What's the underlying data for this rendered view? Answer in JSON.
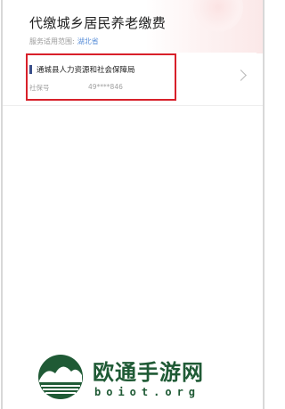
{
  "page": {
    "title": "代缴城乡居民养老缴费",
    "scope_label": "服务适用范围:",
    "scope_value": "湖北省"
  },
  "bureau_card": {
    "name": "通城县人力资源和社会保障局",
    "ssn_label": "社保号",
    "ssn_value": "49****846",
    "chevron_icon": "chevron-right-icon"
  },
  "watermark": {
    "title": "欧通手游网",
    "domain": "boiot.org"
  },
  "colors": {
    "highlight": "#d8202a",
    "link": "#5a8fd8",
    "marker": "#3a4f8a",
    "watermark": "#1f5a35"
  }
}
